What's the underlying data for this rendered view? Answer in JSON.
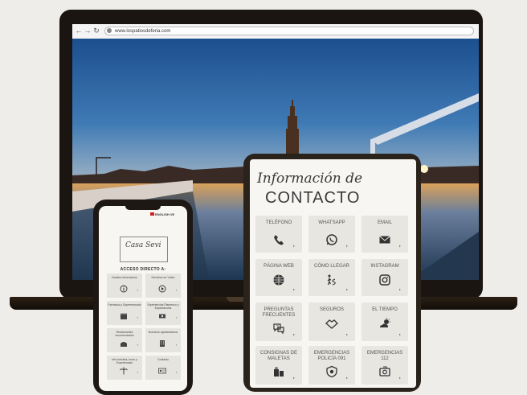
{
  "browser": {
    "url": "www.lospatiosdeferia.com"
  },
  "tablet": {
    "title_script": "Información de",
    "title_caps": "CONTACTO",
    "cells": [
      {
        "label": "TELÉFONO",
        "icon": "phone-icon"
      },
      {
        "label": "WHATSAPP",
        "icon": "whatsapp-icon"
      },
      {
        "label": "EMAIL",
        "icon": "email-icon"
      },
      {
        "label": "PÁGINA WEB",
        "icon": "globe-icon"
      },
      {
        "label": "CÓMO LLEGAR",
        "icon": "walk-route-icon"
      },
      {
        "label": "INSTAGRAM",
        "icon": "instagram-icon"
      },
      {
        "label": "PREGUNTAS FRECUENTES",
        "icon": "faq-icon"
      },
      {
        "label": "SEGUROS",
        "icon": "handshake-icon"
      },
      {
        "label": "EL TIEMPO",
        "icon": "weather-icon"
      },
      {
        "label": "CONSIGNAS DE MALETAS",
        "icon": "luggage-icon"
      },
      {
        "label": "EMERGENCIAS POLICÍA 091",
        "icon": "police-badge-icon"
      },
      {
        "label": "EMERGENCIAS 112",
        "icon": "ambulance-icon"
      }
    ],
    "comma": ","
  },
  "phone": {
    "lang_label": "ENGLISH VE",
    "logo_text": "Casa Sevi",
    "heading": "ACCESO DIRECTO A:",
    "cells": [
      {
        "label": "Nuestra Información",
        "icon": "info-icon"
      },
      {
        "label": "Servicios en Vídeo",
        "icon": "play-icon"
      },
      {
        "label": "Farmacia y Supermercado",
        "icon": "shop-icon"
      },
      {
        "label": "Experiencias Flamenco y Espectáculos",
        "icon": "ticket-icon"
      },
      {
        "label": "Restaurantes recomendados",
        "icon": "restaurant-icon"
      },
      {
        "label": "Nuestros apartamentos",
        "icon": "apartment-icon"
      },
      {
        "label": "Info turística, tours y Experiencias",
        "icon": "palm-icon"
      },
      {
        "label": "Contacto",
        "icon": "contact-card-icon"
      }
    ],
    "comma": ","
  },
  "colors": {
    "background": "#efedea",
    "device_frame": "#1a1510",
    "cell_bg": "#e8e6e1",
    "text": "#3a3a3a"
  }
}
